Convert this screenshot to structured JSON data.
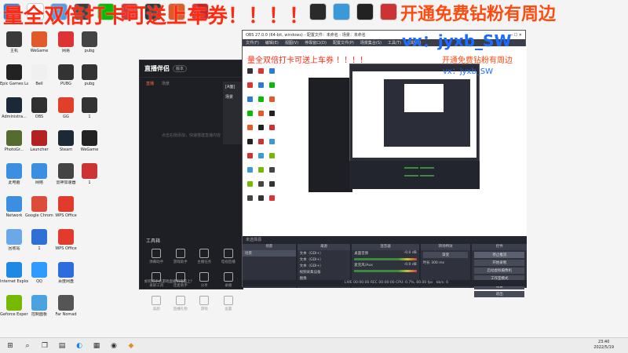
{
  "overlay": {
    "line1": "量全双倍打卡可送上车券！！！！",
    "line1b": "开通免费钻粉有周边",
    "wechat": "vx：jyxb_SW",
    "line2": "量全双倍打卡可送上车券 ！！！！",
    "line2b": "开通免费钻粉有周边",
    "wechat2": "vx：jyxb_SW"
  },
  "desktop": {
    "icons": [
      {
        "label": "主机",
        "icon": "computer-icon",
        "color": "#3a3a3a"
      },
      {
        "label": "WeGame",
        "icon": "wegame-icon",
        "color": "#e05a2a"
      },
      {
        "label": "Epic Games Launcher",
        "icon": "epic-icon",
        "color": "#222222"
      },
      {
        "label": "Bell",
        "icon": "document-icon",
        "color": "#f0f0f0"
      },
      {
        "label": "Administra...",
        "icon": "steam-icon",
        "color": "#1b2838"
      },
      {
        "label": "OBS",
        "icon": "obs-icon",
        "color": "#303030"
      },
      {
        "label": "PhotoGr...",
        "icon": "game-icon",
        "color": "#556b2f"
      },
      {
        "label": "Launcher",
        "icon": "launcher-icon",
        "color": "#b22222"
      },
      {
        "label": "此电脑",
        "icon": "this-pc-icon",
        "color": "#3c8ee0"
      },
      {
        "label": "网络",
        "icon": "network-icon",
        "color": "#3c8ee0"
      },
      {
        "label": "Network",
        "icon": "network-icon",
        "color": "#3c8ee0"
      },
      {
        "label": "Google Chrome",
        "icon": "chrome-icon",
        "color": "#dd4b39"
      },
      {
        "label": "回收站",
        "icon": "recycle-bin-icon",
        "color": "#6aa8e8"
      },
      {
        "label": "1",
        "icon": "file-icon",
        "color": "#2f6fd6"
      },
      {
        "label": "Internet Explorer",
        "icon": "ie-icon",
        "color": "#1e88e5"
      },
      {
        "label": "QQ",
        "icon": "qq-icon",
        "color": "#2f9bff"
      },
      {
        "label": "Geforce Experience",
        "icon": "nvidia-icon",
        "color": "#76b900"
      },
      {
        "label": "控制面板",
        "icon": "control-panel-icon",
        "color": "#4aa3df"
      }
    ],
    "icons_col2": [
      {
        "label": "网易",
        "icon": "netease-icon",
        "color": "#d33"
      },
      {
        "label": "PUBG",
        "icon": "pubg-icon",
        "color": "#333"
      },
      {
        "label": "GG",
        "icon": "gg-icon",
        "color": "#e0402a"
      },
      {
        "label": "Steam",
        "icon": "steam-icon",
        "color": "#1b2838"
      },
      {
        "label": "雷神加速器",
        "icon": "game-icon",
        "color": "#444"
      },
      {
        "label": "WPS Office",
        "icon": "wps-icon",
        "color": "#e23b2e"
      },
      {
        "label": "WPS Office",
        "icon": "wps-icon",
        "color": "#e23b2e"
      },
      {
        "label": "百度网盘",
        "icon": "baidu-icon",
        "color": "#2e6bde"
      },
      {
        "label": "Far Nomad",
        "icon": "game-icon",
        "color": "#555"
      }
    ],
    "icons_col3": [
      {
        "label": "pubg",
        "icon": "pubg-icon",
        "color": "#444"
      },
      {
        "label": "pubg",
        "icon": "pubg-icon",
        "color": "#333"
      },
      {
        "label": "1",
        "icon": "folder-icon",
        "color": "#333"
      },
      {
        "label": "WeGame",
        "icon": "wegame-icon",
        "color": "#222"
      },
      {
        "label": "1",
        "icon": "game-icon",
        "color": "#c33"
      }
    ]
  },
  "stream_app": {
    "logo": "直播伴侣",
    "version": "版本",
    "tabs": [
      "直播",
      "场景"
    ],
    "empty_text": "点击右侧添加，快速搭建直播内容",
    "tools_title": "工具箱",
    "tools": [
      "弹幕助手",
      "游戏助手",
      "主播任务",
      "电视直播",
      "录屏工具",
      "连麦助手",
      "分享",
      "录播",
      "美颜",
      "直播礼物",
      "游戏",
      "设置"
    ],
    "bottom_msg": "如何把手机游戏直播到电脑上？"
  },
  "side_strip": {
    "tab": "[A面]",
    "sub": "场景"
  },
  "obs": {
    "title": "OBS 27.0.0 (64-bit, windows) - 配置文件：未命名 - 场景：未命名",
    "menu": [
      "文件(F)",
      "编辑(E)",
      "视图(V)",
      "停靠窗口(D)",
      "配置文件(P)",
      "场景集合(S)",
      "工具(T)",
      "帮助(H)"
    ],
    "dock_title": "未选择源",
    "scenes": {
      "title": "场景",
      "items": [
        "场景"
      ]
    },
    "sources": {
      "title": "来源",
      "items": [
        "文本（GDI+）",
        "文本（GDI+）",
        "文本（GDI+）",
        "视频采集设备",
        "图像",
        "窗口采集"
      ]
    },
    "mixer": {
      "title": "混音器",
      "tracks": [
        "桌面音频",
        "麦克风/Aux"
      ],
      "levels": [
        "-0.0 dB",
        "-0.0 dB"
      ]
    },
    "transitions": {
      "title": "转场特效",
      "mode": "渐变",
      "duration_label": "时长",
      "duration": "300 ms"
    },
    "controls": {
      "title": "控件",
      "buttons": [
        "停止推流",
        "开始录制",
        "启动虚拟摄像机",
        "工作室模式",
        "设置",
        "退出"
      ]
    },
    "status": "LIVE 00:00:00    REC 00:00:00    CPU: 0.7%, 60.00 fps",
    "status_kbps": "kb/s: 0"
  },
  "topbar_icons": [
    {
      "icon": "wegame-icon",
      "color": "#2e7bd6"
    },
    {
      "icon": "google-icon",
      "color": "#ffffff"
    },
    {
      "icon": "tencent-icon",
      "color": "#4b9ee8"
    },
    {
      "icon": "docs-icon",
      "color": "#3a3a3a"
    },
    {
      "icon": "wechat-icon",
      "color": "#09bb07"
    },
    {
      "icon": "netease-icon",
      "color": "#d33"
    },
    {
      "icon": "obs-icon",
      "color": "#333"
    },
    {
      "icon": "game-icon",
      "color": "#e05a2a"
    },
    {
      "icon": "music-icon",
      "color": "#cc2222"
    },
    {
      "icon": "steam-icon",
      "color": "#2a2a2a"
    },
    {
      "icon": "settings-icon",
      "color": "#3a9ad9"
    },
    {
      "icon": "game-icon",
      "color": "#222"
    },
    {
      "icon": "pubg-icon",
      "color": "#c33"
    }
  ],
  "taskbar": {
    "time": "23:40",
    "date": "2022/5/19",
    "apps": [
      "start-icon",
      "search-icon",
      "task-view-icon",
      "file-explorer-icon",
      "edge-icon",
      "store-icon",
      "obs-icon",
      "stream-app-icon"
    ]
  }
}
